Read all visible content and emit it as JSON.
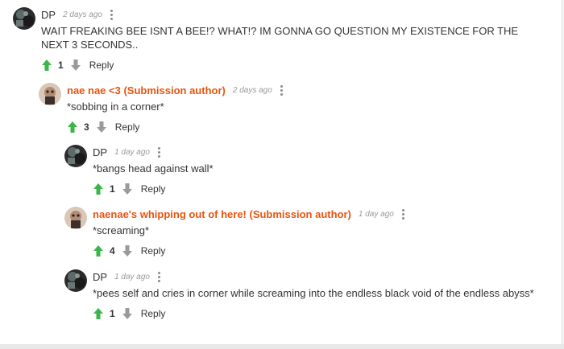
{
  "colors": {
    "upvote": "#3bb54a",
    "downvote": "#9a9a9a",
    "op_author": "#e8540f"
  },
  "comments": [
    {
      "author": "DP",
      "author_tag": "",
      "time": "2 days ago",
      "text": "WAIT FREAKING BEE ISNT A BEE!? WHAT!? IM GONNA GO QUESTION MY EXISTENCE FOR THE NEXT 3 SECONDS..",
      "score": "1",
      "reply_label": "Reply",
      "avatar": "dark-avatar"
    },
    {
      "author": "nae nae <3 (Submission author)",
      "time": "2 days ago",
      "text": "*sobbing in a corner*",
      "score": "3",
      "reply_label": "Reply",
      "avatar": "light-avatar"
    },
    {
      "author": "DP",
      "time": "1 day ago",
      "text": "*bangs head against wall*",
      "score": "1",
      "reply_label": "Reply",
      "avatar": "dark-avatar"
    },
    {
      "author": "naenae's whipping out of here! (Submission author)",
      "time": "1 day ago",
      "text": "*screaming*",
      "score": "4",
      "reply_label": "Reply",
      "avatar": "light-avatar"
    },
    {
      "author": "DP",
      "time": "1 day ago",
      "text": "*pees self and cries in corner while screaming into the endless black void of the endless abyss*",
      "score": "1",
      "reply_label": "Reply",
      "avatar": "dark-avatar"
    }
  ]
}
